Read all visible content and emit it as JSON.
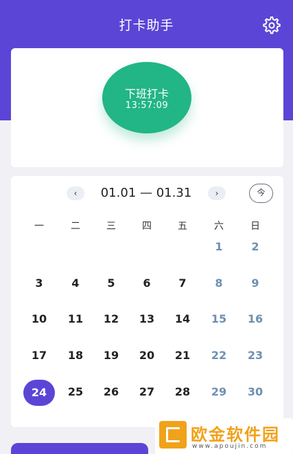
{
  "app": {
    "title": "打卡助手"
  },
  "colors": {
    "accent": "#5b45d6",
    "punch_green": "#22b585",
    "weekend_blue": "#6e8fb3"
  },
  "icons": {
    "settings": "gear-icon"
  },
  "punch": {
    "label": "下班打卡",
    "time": "13:57:09"
  },
  "calendar": {
    "prev_label": "‹",
    "next_label": "›",
    "range": "01.01 — 01.31",
    "today_label": "今",
    "weekdays": [
      "一",
      "二",
      "三",
      "四",
      "五",
      "六",
      "日"
    ],
    "days": [
      [
        "",
        "",
        "",
        "",
        "",
        "1",
        "2"
      ],
      [
        "3",
        "4",
        "5",
        "6",
        "7",
        "8",
        "9"
      ],
      [
        "10",
        "11",
        "12",
        "13",
        "14",
        "15",
        "16"
      ],
      [
        "17",
        "18",
        "19",
        "20",
        "21",
        "22",
        "23"
      ],
      [
        "24",
        "25",
        "26",
        "27",
        "28",
        "29",
        "30"
      ]
    ],
    "selected_day": "24"
  },
  "watermark": {
    "name": "欧金软件园",
    "url": "www.apoujin.com"
  }
}
